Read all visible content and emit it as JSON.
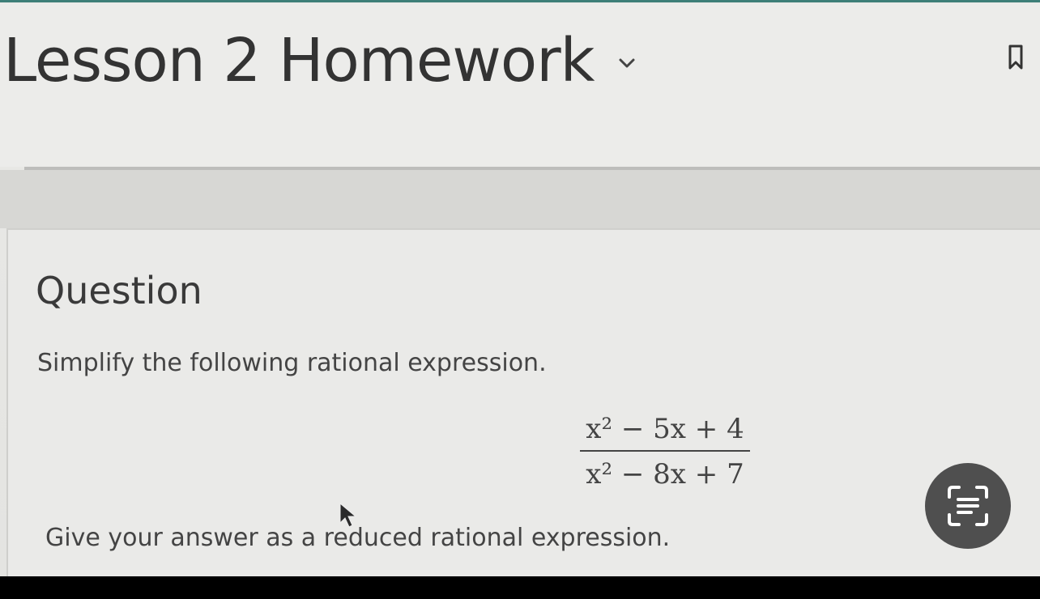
{
  "header": {
    "title": "Lesson 2 Homework"
  },
  "question": {
    "heading": "Question",
    "prompt": "Simplify the following rational expression.",
    "numerator": "x² − 5x + 4",
    "denominator": "x² − 8x + 7",
    "instruction": "Give your answer as a reduced rational expression."
  },
  "icons": {
    "title_dropdown": "chevron-down-icon",
    "bookmark": "bookmark-icon",
    "scan": "text-scan-icon",
    "cursor": "mouse-pointer-icon"
  },
  "colors": {
    "accent": "#3d7f78",
    "scan_button": "#4f4f4f",
    "text": "#3a3a3a"
  }
}
